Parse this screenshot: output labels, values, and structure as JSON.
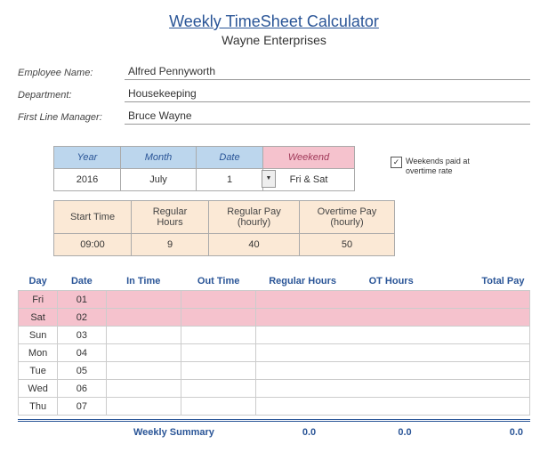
{
  "title": "Weekly TimeSheet Calculator",
  "company": "Wayne Enterprises",
  "employee": {
    "name_label": "Employee Name:",
    "name": "Alfred Pennyworth",
    "dept_label": "Department:",
    "dept": "Housekeeping",
    "mgr_label": "First Line Manager:",
    "mgr": "Bruce Wayne"
  },
  "params": {
    "headers": {
      "year": "Year",
      "month": "Month",
      "date": "Date",
      "weekend": "Weekend"
    },
    "year": "2016",
    "month": "July",
    "date": "1",
    "weekend": "Fri & Sat"
  },
  "checkbox": {
    "checked": "✓",
    "label": "Weekends paid at overtime rate"
  },
  "rates": {
    "headers": {
      "start": "Start Time",
      "reg_hours": "Regular Hours",
      "reg_pay": "Regular Pay (hourly)",
      "ot_pay": "Overtime Pay (hourly)"
    },
    "start": "09:00",
    "reg_hours": "9",
    "reg_pay": "40",
    "ot_pay": "50"
  },
  "week_headers": {
    "day": "Day",
    "date": "Date",
    "in": "In Time",
    "out": "Out Time",
    "reg": "Regular Hours",
    "ot": "OT Hours",
    "pay": "Total Pay"
  },
  "week": [
    {
      "day": "Fri",
      "date": "01",
      "weekend": true
    },
    {
      "day": "Sat",
      "date": "02",
      "weekend": true
    },
    {
      "day": "Sun",
      "date": "03",
      "weekend": false
    },
    {
      "day": "Mon",
      "date": "04",
      "weekend": false
    },
    {
      "day": "Tue",
      "date": "05",
      "weekend": false
    },
    {
      "day": "Wed",
      "date": "06",
      "weekend": false
    },
    {
      "day": "Thu",
      "date": "07",
      "weekend": false
    }
  ],
  "summary": {
    "label": "Weekly Summary",
    "reg": "0.0",
    "ot": "0.0",
    "pay": "0.0"
  }
}
